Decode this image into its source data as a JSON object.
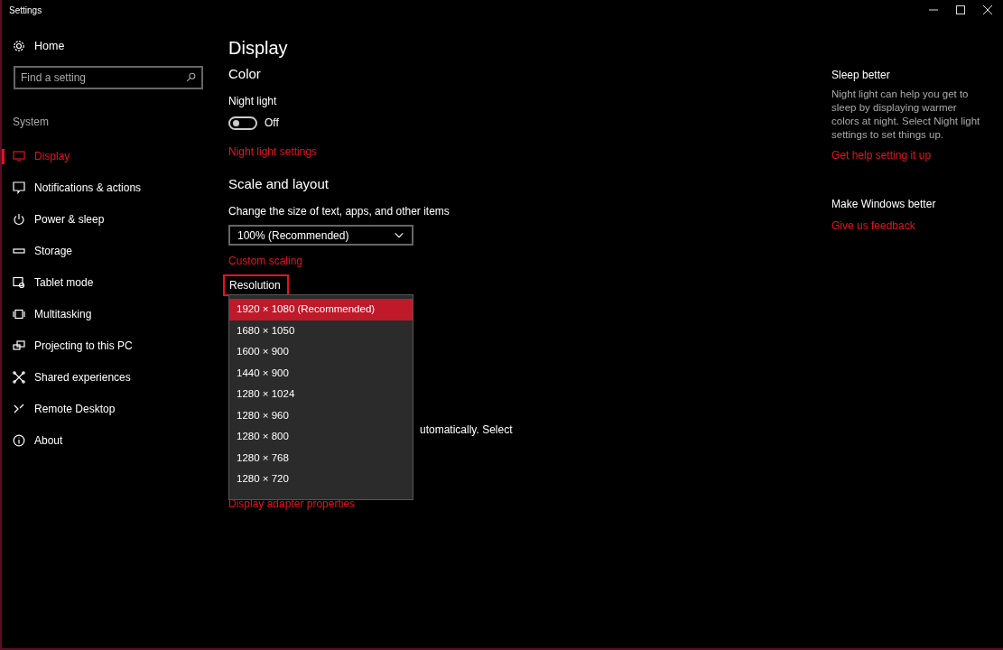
{
  "window": {
    "title": "Settings"
  },
  "sidebar": {
    "home": "Home",
    "search": {
      "placeholder": "Find a setting"
    },
    "section": "System",
    "items": [
      {
        "label": "Display",
        "selected": true
      },
      {
        "label": "Notifications & actions",
        "selected": false
      },
      {
        "label": "Power & sleep",
        "selected": false
      },
      {
        "label": "Storage",
        "selected": false
      },
      {
        "label": "Tablet mode",
        "selected": false
      },
      {
        "label": "Multitasking",
        "selected": false
      },
      {
        "label": "Projecting to this PC",
        "selected": false
      },
      {
        "label": "Shared experiences",
        "selected": false
      },
      {
        "label": "Remote Desktop",
        "selected": false
      },
      {
        "label": "About",
        "selected": false
      }
    ]
  },
  "page": {
    "title": "Display",
    "color": {
      "heading": "Color",
      "night_light": {
        "label": "Night light",
        "on": false,
        "state_text": "Off"
      },
      "link": "Night light settings"
    },
    "scale": {
      "heading": "Scale and layout",
      "size_label": "Change the size of text, apps, and other items",
      "size_value": "100% (Recommended)",
      "link": "Custom scaling"
    },
    "resolution": {
      "label": "Resolution",
      "highlighted": true,
      "options": [
        {
          "label": "1920 × 1080 (Recommended)",
          "selected": true
        },
        {
          "label": "1680 × 1050",
          "selected": false
        },
        {
          "label": "1600 × 900",
          "selected": false
        },
        {
          "label": "1440 × 900",
          "selected": false
        },
        {
          "label": "1280 × 1024",
          "selected": false
        },
        {
          "label": "1280 × 960",
          "selected": false
        },
        {
          "label": "1280 × 800",
          "selected": false
        },
        {
          "label": "1280 × 768",
          "selected": false
        },
        {
          "label": "1280 × 720",
          "selected": false
        }
      ]
    },
    "partial_text": "utomatically. Select",
    "adapter_link": "Display adapter properties"
  },
  "aside": {
    "sections": [
      {
        "heading": "Sleep better",
        "body": "Night light can help you get to sleep by displaying warmer colors at night. Select Night light settings to set things up.",
        "link": "Get help setting it up"
      },
      {
        "heading": "Make Windows better",
        "link": "Give us feedback"
      }
    ]
  }
}
